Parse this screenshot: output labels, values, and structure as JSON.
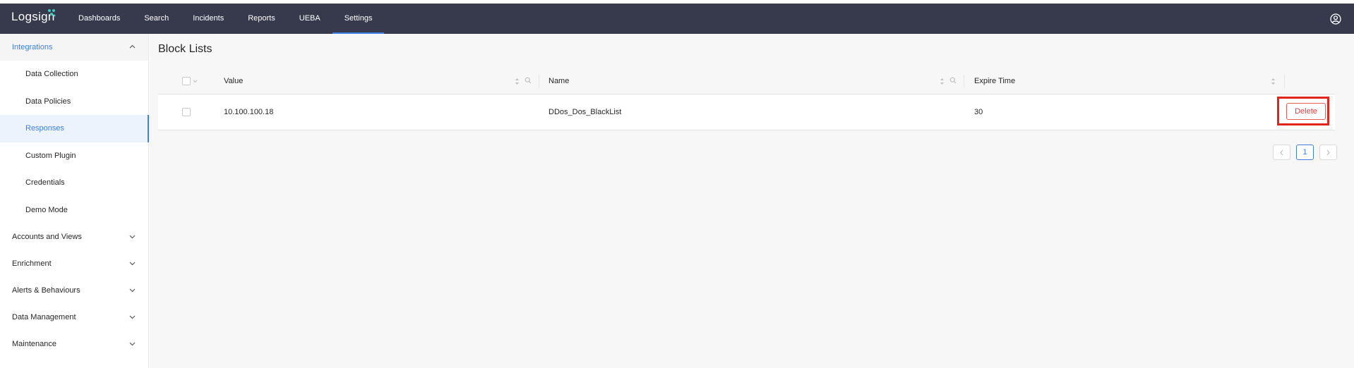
{
  "topbar": {
    "logo": "Logsign",
    "nav": [
      "Dashboards",
      "Search",
      "Incidents",
      "Reports",
      "UEBA",
      "Settings"
    ],
    "active_nav": "Settings"
  },
  "sidebar": {
    "integrations_label": "Integrations",
    "sub_items": [
      "Data Collection",
      "Data Policies",
      "Responses",
      "Custom Plugin",
      "Credentials",
      "Demo Mode"
    ],
    "active_sub": "Responses",
    "groups": [
      "Accounts and Views",
      "Enrichment",
      "Alerts & Behaviours",
      "Data Management",
      "Maintenance"
    ]
  },
  "main": {
    "title": "Block Lists",
    "columns": {
      "value": "Value",
      "name": "Name",
      "expire": "Expire Time"
    },
    "rows": [
      {
        "value": "10.100.100.18",
        "name": "DDos_Dos_BlackList",
        "expire": "30",
        "action": "Delete"
      }
    ],
    "pagination": {
      "current": "1"
    }
  },
  "colors": {
    "topbar": "#373a4d",
    "accent": "#3f7fe8",
    "danger": "#e33b3b",
    "highlight": "#e3241b"
  }
}
